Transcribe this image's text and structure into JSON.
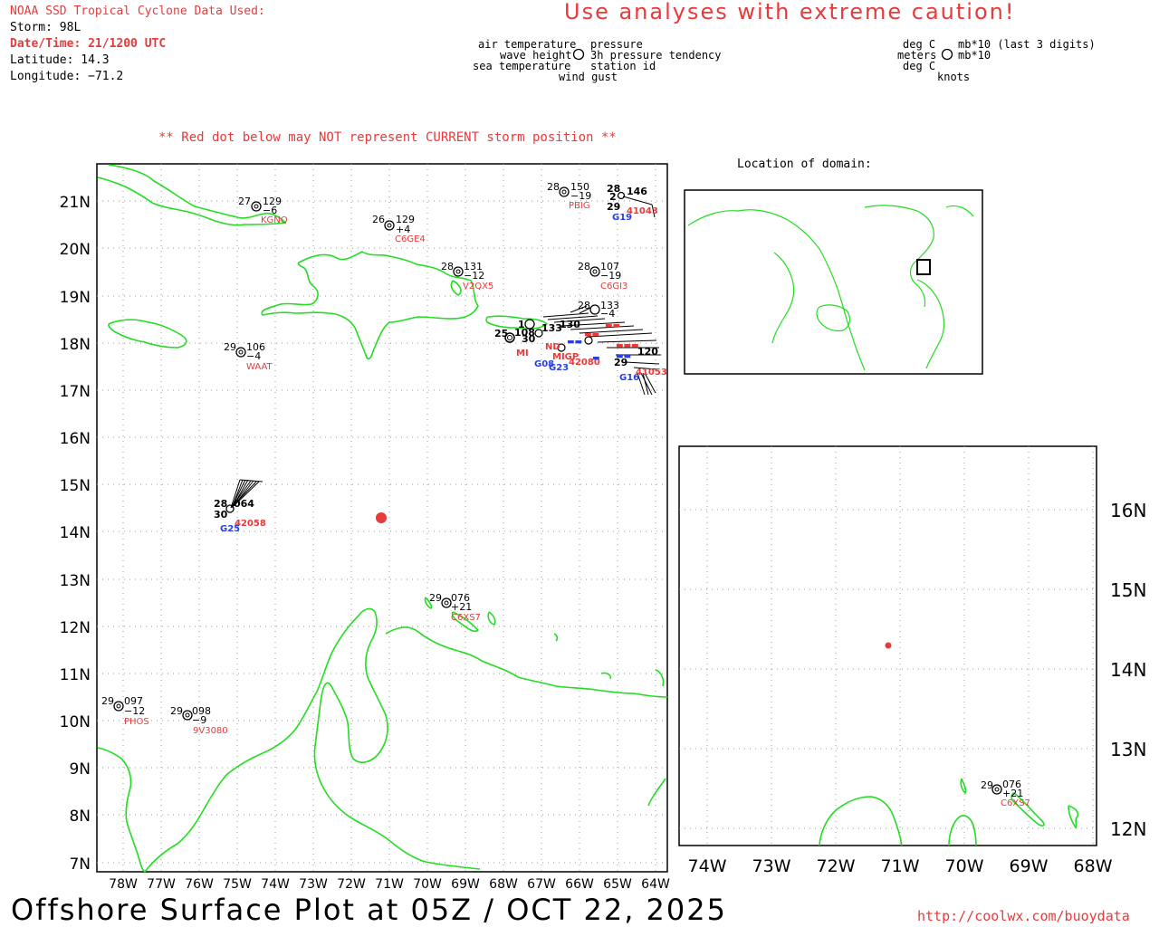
{
  "header": {
    "title": "NOAA SSD Tropical Cyclone Data Used:",
    "storm": "Storm: 98L",
    "datetime": "Date/Time: 21/1200 UTC",
    "latitude": "Latitude: 14.3",
    "longitude": "Longitude: −71.2",
    "caution": "Use analyses with extreme caution!"
  },
  "legend_left": {
    "air_temp": "air temperature",
    "wave_height": "wave height",
    "sea_temp": "sea temperature",
    "pressure": "pressure",
    "pressure_tendency": "3h pressure tendency",
    "station_id": "station id",
    "wind_gust": "wind gust"
  },
  "legend_right": {
    "deg_c1": "deg C",
    "meters": "meters",
    "deg_c2": "deg C",
    "mb1": "mb*10 (last 3 digits)",
    "mb2": "mb*10",
    "knots": "knots"
  },
  "note": "** Red dot below may NOT represent CURRENT storm position **",
  "inset": {
    "title": "Location of domain:"
  },
  "main_map": {
    "lat_labels": [
      "21N",
      "20N",
      "19N",
      "18N",
      "17N",
      "16N",
      "15N",
      "14N",
      "13N",
      "12N",
      "11N",
      "10N",
      "9N",
      "8N",
      "7N"
    ],
    "lon_labels": [
      "78W",
      "77W",
      "76W",
      "75W",
      "74W",
      "73W",
      "72W",
      "71W",
      "70W",
      "69W",
      "68W",
      "67W",
      "66W",
      "65W",
      "64W"
    ],
    "stations": [
      {
        "temp": "27",
        "pres": "129",
        "tend": "−6",
        "id": "KGNQ"
      },
      {
        "temp": "26",
        "pres": "129",
        "tend": "+4",
        "id": "C6GE4"
      },
      {
        "temp": "28",
        "pres": "150",
        "tend": "−19",
        "id": "PBIG"
      },
      {
        "temp": "28",
        "pres": "131",
        "tend": "−12",
        "id": "V2QX5"
      },
      {
        "temp": "28",
        "pres": "107",
        "tend": "−19",
        "id": "C6GI3"
      },
      {
        "temp": "28",
        "pres": "133",
        "tend": "−4",
        "id": ""
      },
      {
        "temp": "29",
        "pres": "106",
        "tend": "−4",
        "id": "WAAT"
      },
      {
        "temp": "29",
        "pres": "076",
        "tend": "+21",
        "id": "C6XS7"
      },
      {
        "temp": "29",
        "pres": "097",
        "tend": "−12",
        "id": "PHOS"
      },
      {
        "temp": "29",
        "pres": "098",
        "tend": "−9",
        "id": "9V3080"
      }
    ],
    "buoy_42058": {
      "temp": "28",
      "pres": "064",
      "sst": "30",
      "id": "42058",
      "wave": "G25"
    },
    "buoy_41043": {
      "temp": "28",
      "pres": "146",
      "wave": "2",
      "sst": "29",
      "id": "41043",
      "gust": "G19"
    },
    "cluster_labels": {
      "t1": "25",
      "p1": "108",
      "s1": "30",
      "id1": "MI",
      "g1": "G08",
      "g2": "G23",
      "v1": "1",
      "v2": "133",
      "v3": "130",
      "v4": "29",
      "v5": "120",
      "v6": "G16",
      "r1": "ND",
      "r2": "MIGP",
      "r3": "42080",
      "r4": "41053"
    },
    "storm_position": {
      "lat": 14.3,
      "lon": -71.2
    }
  },
  "zoom_map": {
    "lat_labels": [
      "16N",
      "15N",
      "14N",
      "13N",
      "12N"
    ],
    "lon_labels": [
      "74W",
      "73W",
      "72W",
      "71W",
      "70W",
      "69W",
      "68W"
    ],
    "station": {
      "temp": "29",
      "pres": "076",
      "tend": "+21",
      "id": "C6XS7"
    }
  },
  "footer": {
    "title": "Offshore Surface Plot at 05Z / OCT 22, 2025",
    "url": "http://coolwx.com/buoydata"
  },
  "colors": {
    "coast": "#22dd22",
    "storm_dot": "#e83a3a",
    "station_id": "#e83a3a",
    "gust": "#2a3ee8",
    "grid": "#9a9a9a"
  }
}
